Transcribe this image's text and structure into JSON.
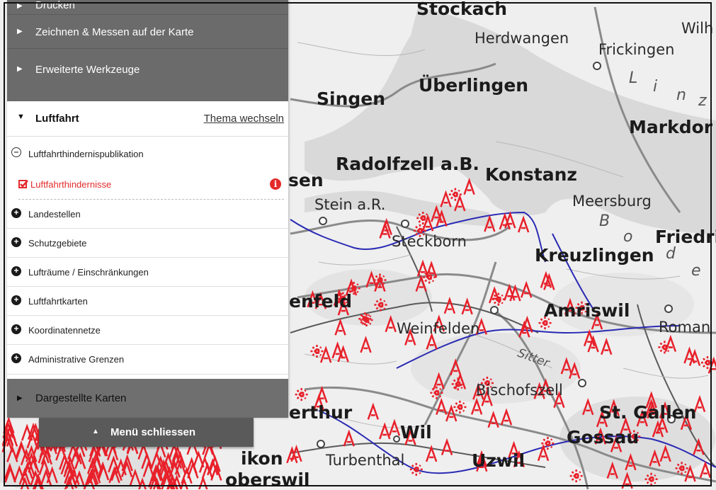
{
  "menu": {
    "top_rows": [
      {
        "label": "Drucken"
      },
      {
        "label": "Zeichnen & Messen auf der Karte"
      },
      {
        "label": "Erweiterte Werkzeuge"
      }
    ],
    "section": {
      "title": "Luftfahrt",
      "switch_link": "Thema wechseln"
    },
    "publication_group": "Luftfahrthindernispublikation",
    "selected_layer": "Luftfahrthindernisse",
    "layer_groups": [
      "Landestellen",
      "Schutzgebiete",
      "Lufträume / Einschränkungen",
      "Luftfahrtkarten",
      "Koordinatennetze",
      "Administrative Grenzen"
    ],
    "bottom_row": "Dargestellte Karten",
    "close_button": "Menü schliessen"
  },
  "map": {
    "labels": [
      "Stockach",
      "Herdwangen",
      "Frickingen",
      "Wilh",
      "Singen",
      "Überlingen",
      "Markdor",
      "Radolfzell a.B.",
      "Konstanz",
      "Meersburg",
      "Friedric",
      "sen",
      "Stein a.R.",
      "Steckborn",
      "Kreuzlingen",
      "enfeld",
      "Amriswil",
      "Weinfelden",
      "Roman",
      "Sitter",
      "Bischofszell",
      "erthur",
      "Wil",
      "St. Gallen",
      "Gossau",
      "Turbenthal",
      "Uzwil",
      "ikon",
      "oberswil"
    ],
    "lake_letters": [
      "L",
      "i",
      "n",
      "z",
      "B",
      "o",
      "d",
      "e"
    ],
    "obstacle_color": "#e8202a",
    "border_color": "#2a2ab4"
  }
}
